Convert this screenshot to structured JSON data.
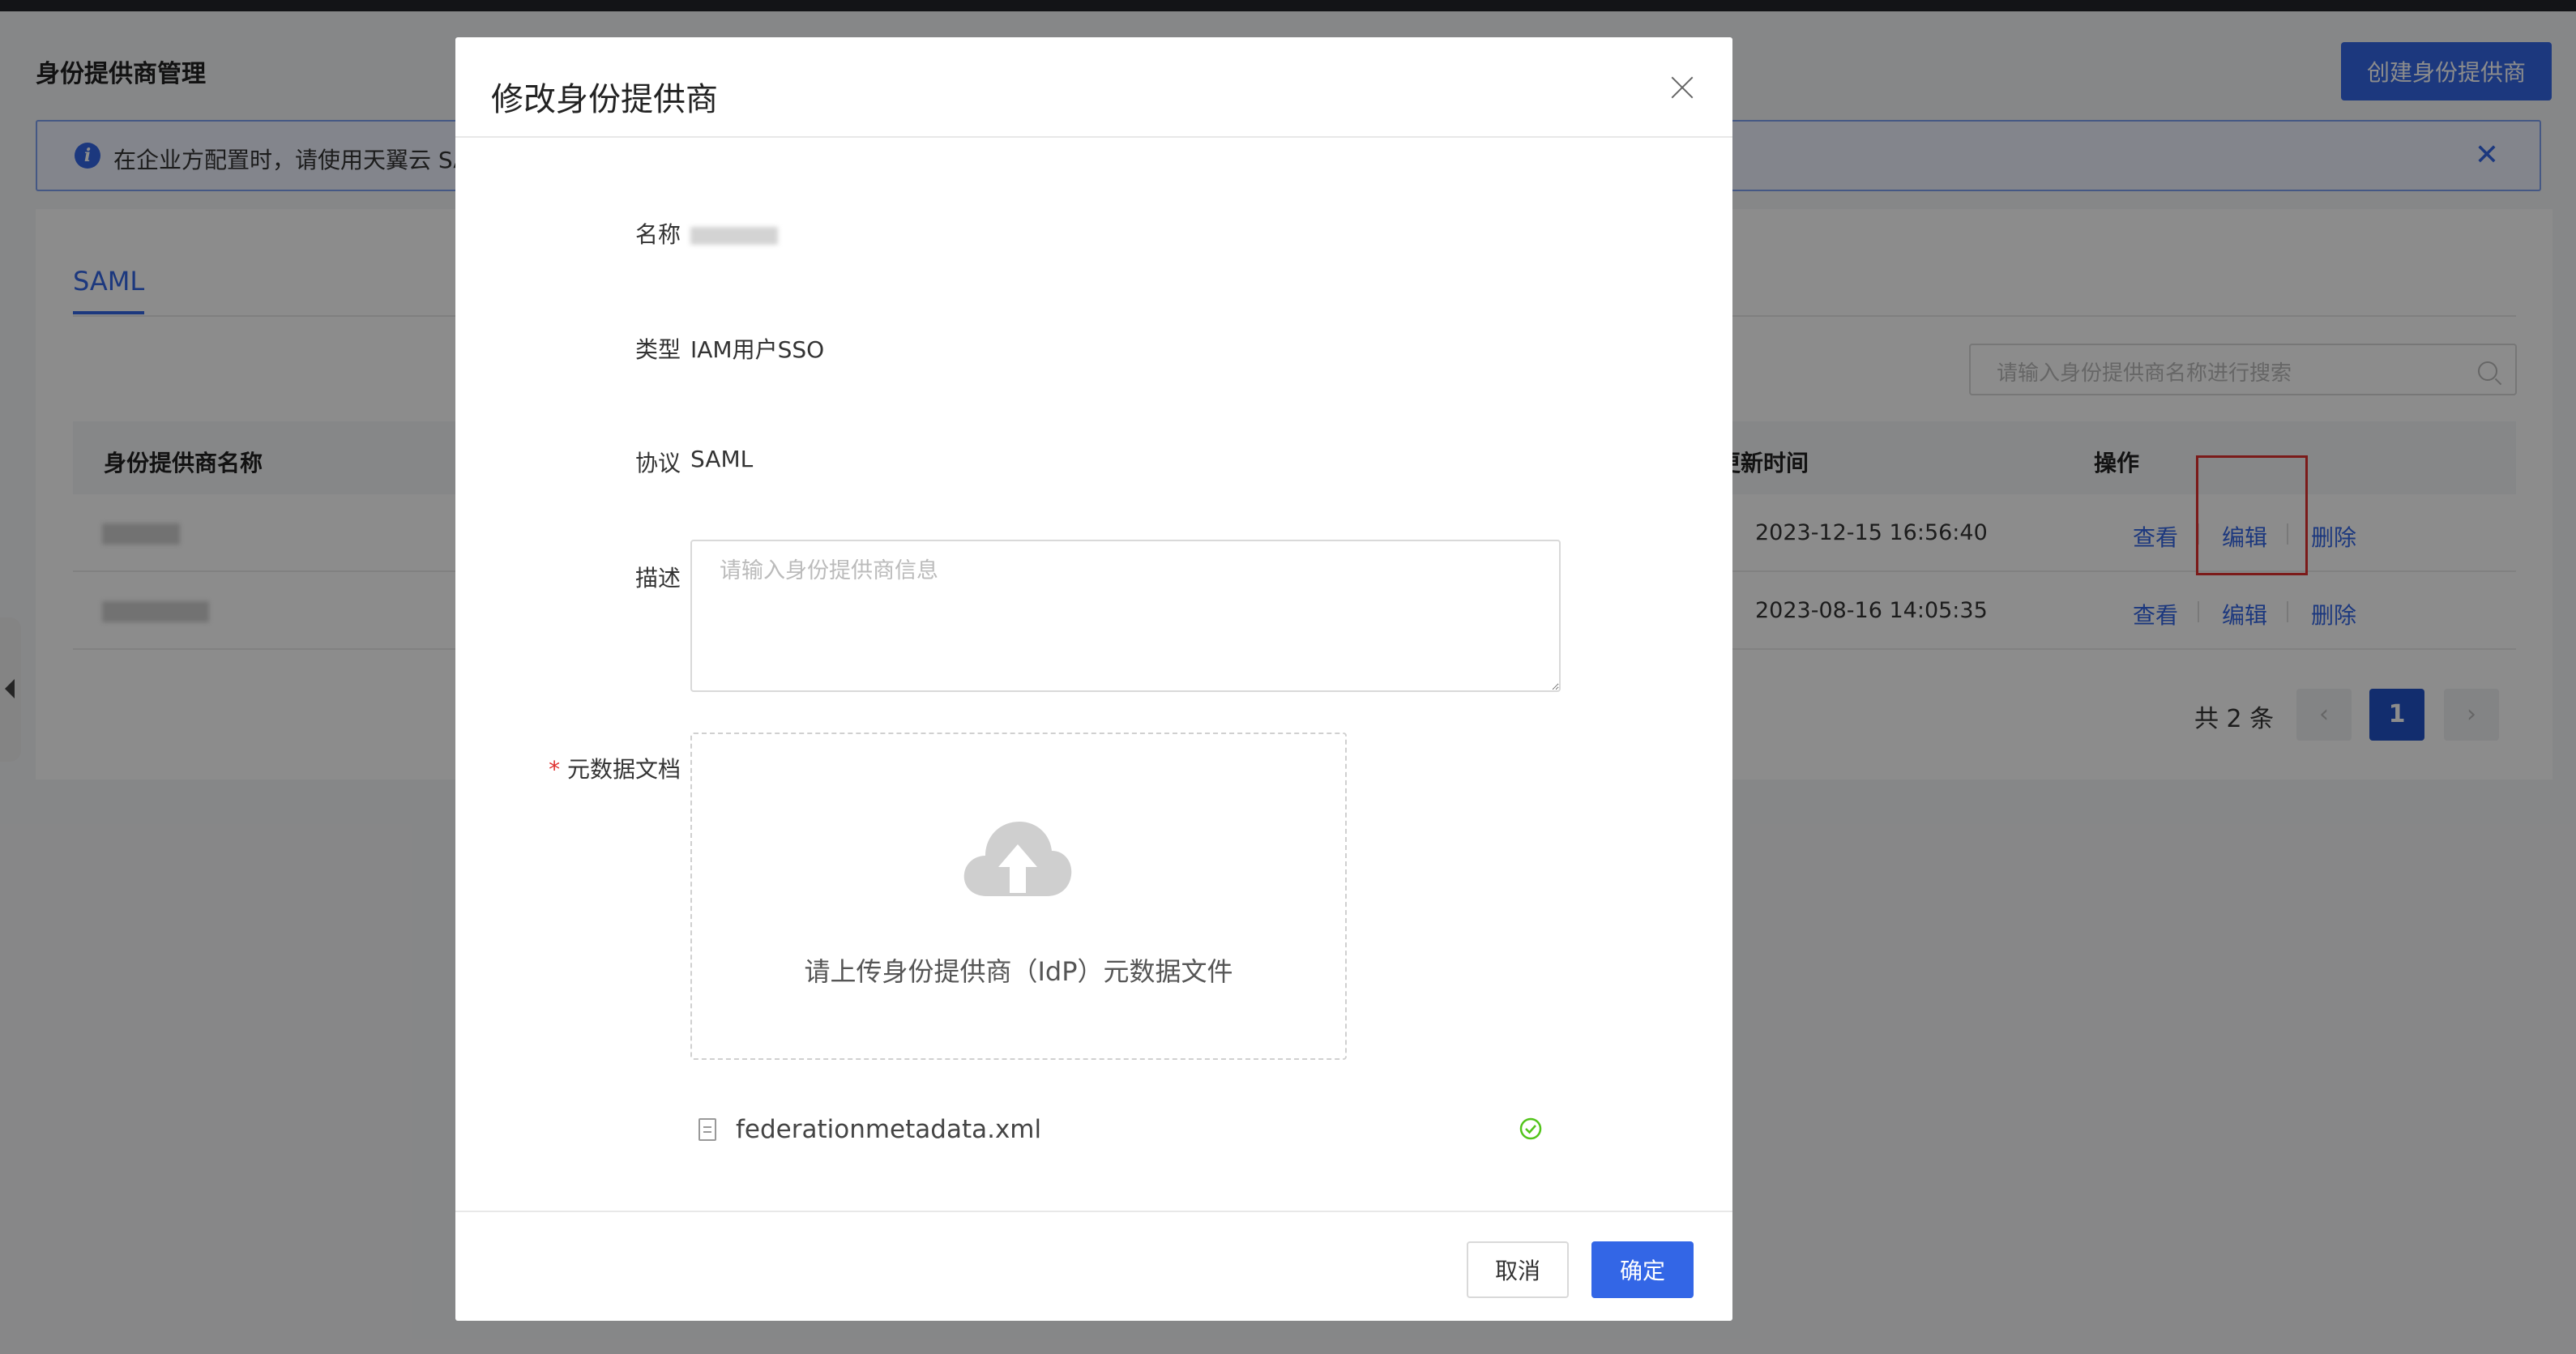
{
  "page": {
    "title": "身份提供商管理",
    "create_button": "创建身份提供商"
  },
  "info_bar": {
    "text": "在企业方配置时，请使用天翼云 SA",
    "icon": "info-icon",
    "close_icon": "close-icon"
  },
  "tabs": [
    {
      "label": "SAML",
      "active": true
    }
  ],
  "search": {
    "placeholder": "请输入身份提供商名称进行搜索",
    "icon": "search-icon"
  },
  "table": {
    "columns": {
      "name": "身份提供商名称",
      "updated": "更新时间",
      "actions": "操作"
    },
    "rows": [
      {
        "updated": "2023-12-15 16:56:40",
        "view": "查看",
        "edit": "编辑",
        "delete": "删除"
      },
      {
        "updated": "2023-08-16 14:05:35",
        "view": "查看",
        "edit": "编辑",
        "delete": "删除"
      }
    ]
  },
  "pagination": {
    "total": "共 2 条",
    "current": "1",
    "prev": "‹",
    "next": "›"
  },
  "modal": {
    "title": "修改身份提供商",
    "fields": {
      "name_label": "名称",
      "type_label": "类型",
      "type_value": "IAM用户SSO",
      "protocol_label": "协议",
      "protocol_value": "SAML",
      "desc_label": "描述",
      "desc_placeholder": "请输入身份提供商信息",
      "metadata_required_mark": "*",
      "metadata_label": "元数据文档"
    },
    "upload": {
      "hint": "请上传身份提供商（IdP）元数据文件",
      "icon": "cloud-upload-icon"
    },
    "file": {
      "name": "federationmetadata.xml",
      "status_icon": "check-circle-icon",
      "status_color": "#52c41a"
    },
    "buttons": {
      "cancel": "取消",
      "ok": "确定"
    }
  },
  "colors": {
    "primary": "#3366e6",
    "highlight_box": "#e0302f"
  }
}
